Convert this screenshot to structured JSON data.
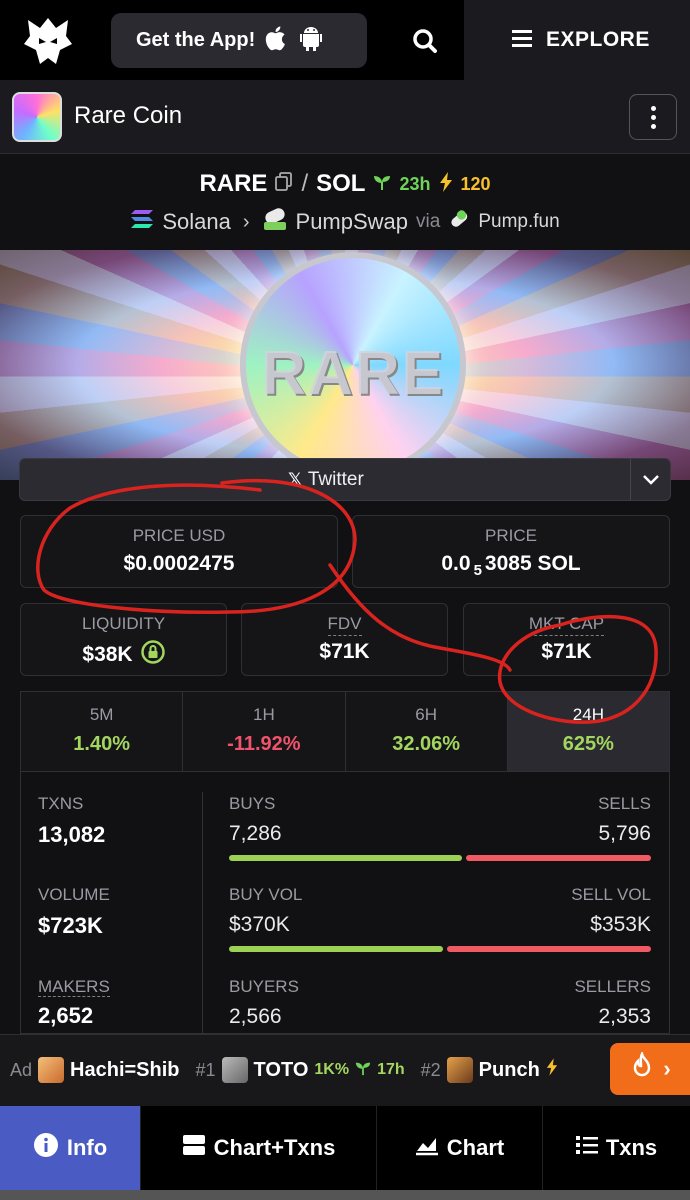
{
  "topbar": {
    "get_app_label": "Get the App!",
    "explore_label": "EXPLORE"
  },
  "token": {
    "name": "Rare Coin"
  },
  "pair": {
    "base": "RARE",
    "quote": "SOL",
    "age": "23h",
    "boost": "120",
    "chain": "Solana",
    "dex": "PumpSwap",
    "via_label": "via",
    "launchpad": "Pump.fun"
  },
  "banner": {
    "coin_text": "RARE"
  },
  "social": {
    "twitter_label": "Twitter"
  },
  "stats_cards": {
    "price_usd_label": "PRICE USD",
    "price_usd": "$0.0002475",
    "price_label": "PRICE",
    "price_prefix": "0.0",
    "price_zeros": "5",
    "price_suffix": "3085 SOL",
    "liquidity_label": "LIQUIDITY",
    "liquidity": "$38K",
    "fdv_label": "FDV",
    "fdv": "$71K",
    "mktcap_label": "MKT CAP",
    "mktcap": "$71K"
  },
  "timeframes": [
    {
      "key": "5M",
      "change": "1.40%"
    },
    {
      "key": "1H",
      "change": "-11.92%"
    },
    {
      "key": "6H",
      "change": "32.06%"
    },
    {
      "key": "24H",
      "change": "625%"
    }
  ],
  "txn_stats": {
    "txns_label": "TXNS",
    "txns": "13,082",
    "buys_label": "BUYS",
    "buys": "7,286",
    "sells_label": "SELLS",
    "sells": "5,796",
    "buys_fraction": 0.557,
    "volume_label": "VOLUME",
    "volume": "$723K",
    "buy_vol_label": "BUY VOL",
    "buy_vol": "$370K",
    "sell_vol_label": "SELL VOL",
    "sell_vol": "$353K",
    "buy_vol_fraction": 0.512,
    "makers_label": "MAKERS",
    "makers": "2,652",
    "buyers_label": "BUYERS",
    "buyers": "2,566",
    "sellers_label": "SELLERS",
    "sellers": "2,353"
  },
  "ticker": {
    "ad_label": "Ad",
    "item1_name": "Hachi=Shib",
    "item2_rank": "#1",
    "item2_name": "TOTO",
    "item2_pct": "1K%",
    "item2_age": "17h",
    "item3_rank": "#2",
    "item3_name": "Punch"
  },
  "bottom_tabs": {
    "info": "Info",
    "chart_txns": "Chart+Txns",
    "chart": "Chart",
    "txns": "Txns"
  },
  "colors": {
    "accent": "#4a5bc4",
    "positive": "#a3d65f",
    "negative": "#f0536b",
    "hot": "#f26d1a",
    "annotation": "#d8231f"
  }
}
